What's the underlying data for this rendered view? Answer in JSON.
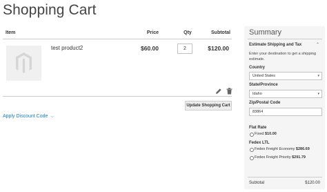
{
  "page": {
    "title": "Shopping Cart"
  },
  "cart": {
    "headers": {
      "item": "Item",
      "price": "Price",
      "qty": "Qty",
      "subtotal": "Subtotal"
    },
    "items": [
      {
        "name": "test product2",
        "price": "$60.00",
        "qty": "2",
        "subtotal": "$120.00"
      }
    ],
    "actions": {
      "edit_icon": "pencil-icon",
      "delete_icon": "trash-icon"
    },
    "update_button": "Update Shopping Cart",
    "discount_link": "Apply Discount Code",
    "discount_chevron": "⌵"
  },
  "summary": {
    "title": "Summary",
    "estimate": {
      "title": "Estimate Shipping and Tax",
      "chevron": "⌃",
      "description": "Enter your destination to get a shipping estimate.",
      "country_label": "Country",
      "country_value": "United States",
      "state_label": "State/Province",
      "state_value": "Idaho",
      "zip_label": "Zip/Postal Code",
      "zip_value": "83864",
      "select_caret": "▾"
    },
    "flat_rate": {
      "title": "Flat Rate",
      "option_label": "Fixed",
      "option_price": "$10.00"
    },
    "fedex": {
      "title": "Fedex LTL",
      "options": [
        {
          "label": "Fedex Freight Economy",
          "price": "$286.69"
        },
        {
          "label": "Fedex Freight Priority",
          "price": "$291.79"
        }
      ]
    },
    "subtotal_label": "Subtotal",
    "subtotal_value": "$120.00"
  },
  "colors": {
    "link": "#1979c3",
    "sidebar_bg": "#f5f5f5",
    "button_bg": "#eeeeee"
  }
}
